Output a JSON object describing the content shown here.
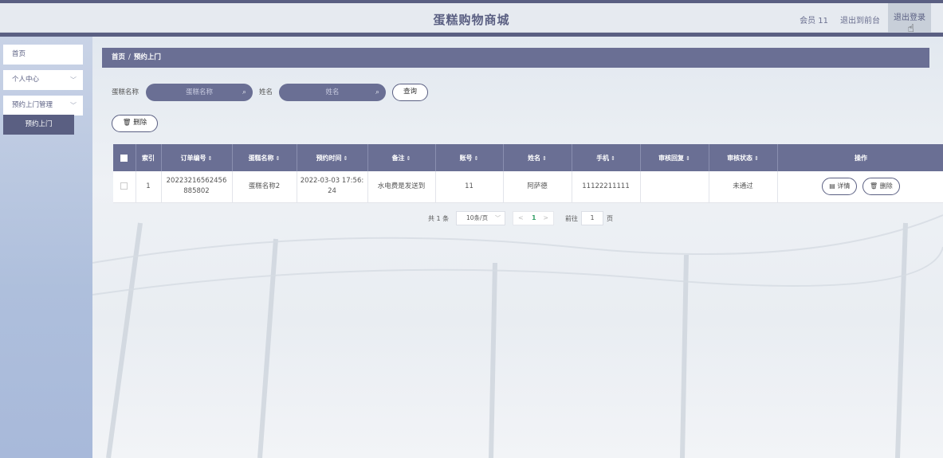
{
  "header": {
    "title": "蛋糕购物商城",
    "member": "会员 11",
    "to_front": "退出到前台",
    "logout": "退出登录"
  },
  "sidebar": {
    "items": [
      {
        "label": "首页"
      },
      {
        "label": "个人中心"
      },
      {
        "label": "预约上门管理"
      }
    ],
    "active_sub": "预约上门"
  },
  "breadcrumb": {
    "home": "首页",
    "separator": "/",
    "current": "预约上门"
  },
  "search": {
    "cake_label": "蛋糕名称",
    "cake_placeholder": "蛋糕名称",
    "name_label": "姓名",
    "name_placeholder": "姓名",
    "query_button": "查询",
    "delete_button": "删除"
  },
  "table": {
    "columns": [
      "索引",
      "订单编号",
      "蛋糕名称",
      "预约时间",
      "备注",
      "账号",
      "姓名",
      "手机",
      "审核回复",
      "审核状态",
      "操作"
    ],
    "rows": [
      {
        "index": "1",
        "order_no": "20223216562456885802",
        "cake_name": "蛋糕名称2",
        "time": "2022-03-03 17:56:24",
        "remark": "水电费是发送到",
        "account": "11",
        "name": "阿萨德",
        "phone": "11122211111",
        "reply": "",
        "status": "未通过",
        "detail_button": "详情",
        "delete_button": "删除"
      }
    ]
  },
  "pagination": {
    "total": "共 1 条",
    "page_size": "10条/页",
    "current_page": "1",
    "goto_label": "前往",
    "goto_value": "1",
    "page_unit": "页"
  },
  "colors": {
    "primary": "#5a5f82",
    "header_bg": "#e6eaf0",
    "sidebar_bg": "#aebfdc",
    "status_ok": "#3aa36b"
  }
}
